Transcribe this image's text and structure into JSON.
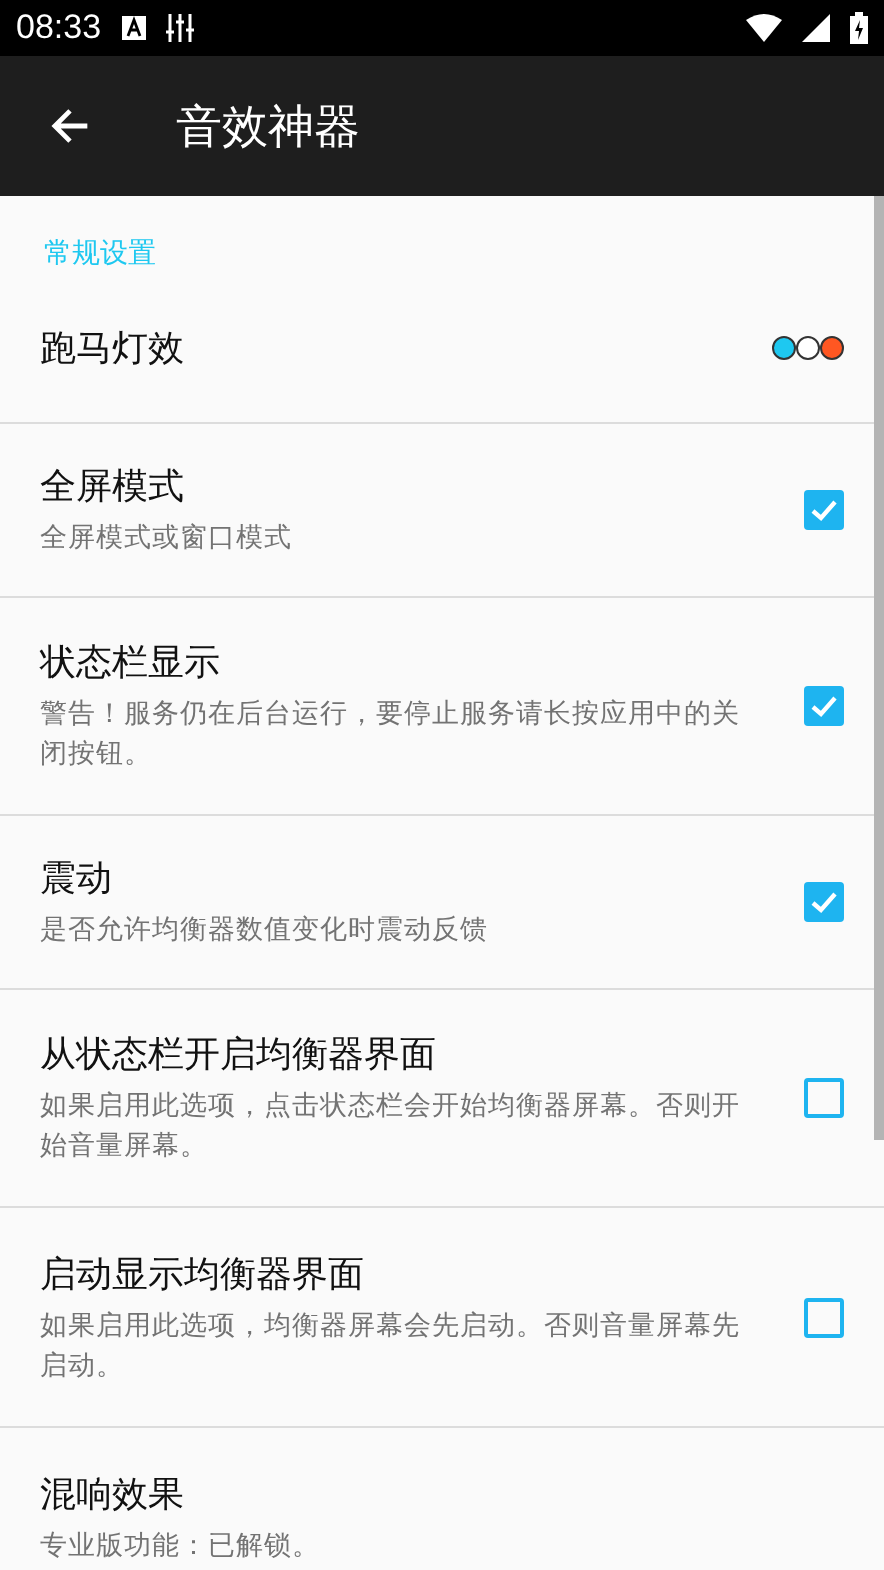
{
  "status_bar": {
    "time": "08:33"
  },
  "toolbar": {
    "title": "音效神器"
  },
  "section": {
    "title": "常规设置"
  },
  "items": [
    {
      "kind": "swatches",
      "title": "跑马灯效",
      "colors": [
        {
          "color": "#1ec8f0"
        },
        {
          "color": "#ffffff"
        },
        {
          "color": "#ff5722"
        }
      ]
    },
    {
      "kind": "checkbox",
      "title": "全屏模式",
      "summary": "全屏模式或窗口模式",
      "checked": true
    },
    {
      "kind": "checkbox",
      "title": "状态栏显示",
      "summary": "警告！服务仍在后台运行，要停止服务请长按应用中的关闭按钮。",
      "checked": true
    },
    {
      "kind": "checkbox",
      "title": "震动",
      "summary": "是否允许均衡器数值变化时震动反馈",
      "checked": true
    },
    {
      "kind": "checkbox",
      "title": "从状态栏开启均衡器界面",
      "summary": "如果启用此选项，点击状态栏会开始均衡器屏幕。否则开始音量屏幕。",
      "checked": false
    },
    {
      "kind": "checkbox",
      "title": "启动显示均衡器界面",
      "summary": "如果启用此选项，均衡器屏幕会先启动。否则音量屏幕先启动。",
      "checked": false
    },
    {
      "kind": "plain",
      "title": "混响效果",
      "summary": "专业版功能：已解锁。"
    }
  ]
}
